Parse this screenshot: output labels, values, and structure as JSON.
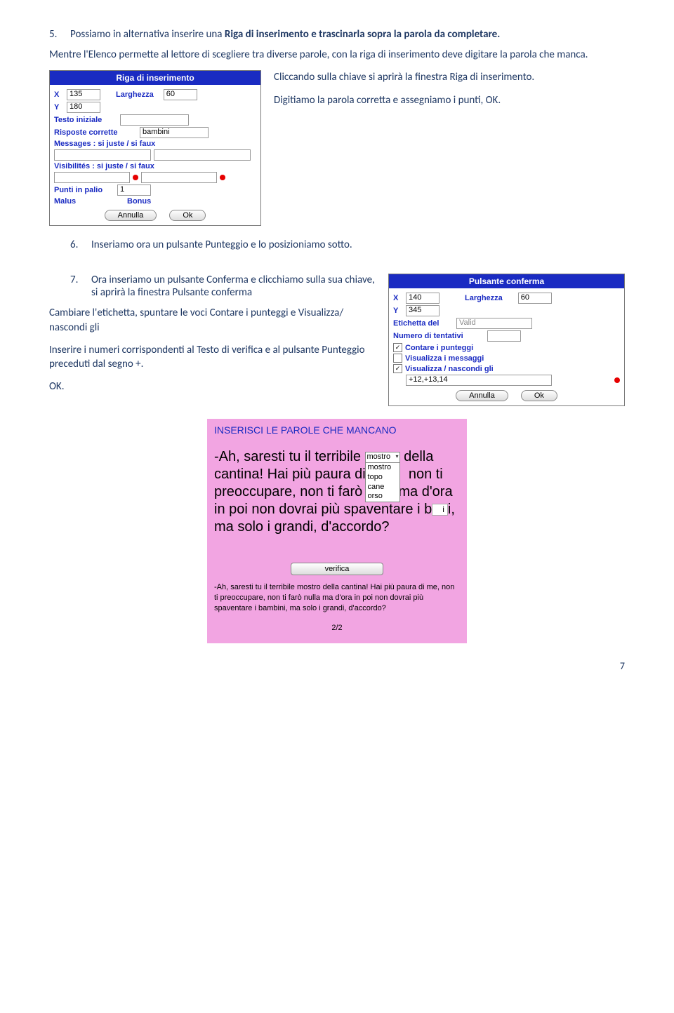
{
  "page_number": "7",
  "items": {
    "5": {
      "num": "5.",
      "text_a": "Possiamo in alternativa inserire una ",
      "text_b": "Riga di inserimento e trascinarla sopra la parola da completare."
    },
    "para1": "Mentre l'Elenco permette al lettore di scegliere tra diverse parole, con la riga di inserimento deve digitare la parola che manca.",
    "side1a": "Cliccando sulla chiave si aprirà la finestra Riga di inserimento.",
    "side1b": "Digitiamo la parola corretta e assegniamo i punti, OK.",
    "6": {
      "num": "6.",
      "text": "Inseriamo ora un pulsante Punteggio e lo posizioniamo sotto."
    },
    "7": {
      "num": "7.",
      "text": "Ora inseriamo  un pulsante Conferma e clicchiamo sulla sua chiave, si aprirà la finestra Pulsante conferma"
    },
    "para2": "Cambiare l'etichetta, spuntare le voci Contare i punteggi e Visualizza/ nascondi gli",
    "para3": "Inserire i numeri corrispondenti al Testo di verifica e al pulsante Punteggio preceduti dal segno +.",
    "ok": "OK."
  },
  "dlg1": {
    "title": "Riga di inserimento",
    "x_lbl": "X",
    "x_val": "135",
    "larg_lbl": "Larghezza",
    "larg_val": "60",
    "y_lbl": "Y",
    "y_val": "180",
    "testo_iniziale": "Testo iniziale",
    "risposte_corrette": "Risposte corrette",
    "risposte_val": "bambini",
    "messages": "Messages : si juste / si faux",
    "visibilites": "Visibilités : si juste / si faux",
    "punti": "Punti in palio",
    "punti_val": "1",
    "malus": "Malus",
    "bonus": "Bonus",
    "annulla": "Annulla",
    "ok": "Ok"
  },
  "dlg2": {
    "title": "Pulsante conferma",
    "x_lbl": "X",
    "x_val": "140",
    "larg_lbl": "Larghezza",
    "larg_val": "60",
    "y_lbl": "Y",
    "y_val": "345",
    "etichetta": "Etichetta del",
    "etichetta_val": "Valid",
    "numero": "Numero di tentativi",
    "contare": "Contare i punteggi",
    "visualizza_msg": "Visualizza i messaggi",
    "visualizza_nasc": "Visualizza / nascondi gli",
    "ids": "+12,+13,14",
    "annulla": "Annulla",
    "ok": "Ok"
  },
  "pink": {
    "header": "INSERISCI LE PAROLE CHE MANCANO",
    "line1a": "-Ah, saresti tu il terribile ",
    "combo_val": "mostro",
    "options": [
      "mostro",
      "topo",
      "cane",
      "orso"
    ],
    "line1b": " della cantina! Hai più paura di",
    "line1c": "non ti preoccupare, non ti farò",
    "line1d": "ma d'ora in poi non dovrai più spaventare i b",
    "box_partial": "i",
    "line1e": "i, ma solo i grandi, d'accordo?",
    "verifica": "verifica",
    "answer": "-Ah, saresti tu il terribile mostro della cantina! Hai più paura di me, non ti preoccupare, non ti farò nulla ma d'ora in poi non dovrai più spaventare i bambini, ma solo i grandi, d'accordo?",
    "pager": "2/2"
  }
}
